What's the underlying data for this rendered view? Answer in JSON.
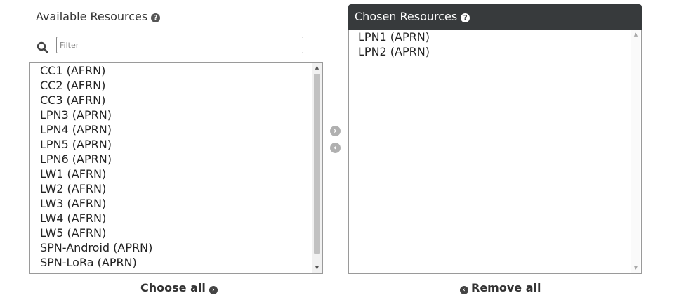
{
  "available": {
    "title": "Available Resources",
    "help_icon": "?",
    "filter_placeholder": "Filter",
    "items": [
      "CC1 (AFRN)",
      "CC2 (AFRN)",
      "CC3 (AFRN)",
      "LPN3 (APRN)",
      "LPN4 (APRN)",
      "LPN5 (APRN)",
      "LPN6 (APRN)",
      "LW1 (AFRN)",
      "LW2 (AFRN)",
      "LW3 (AFRN)",
      "LW4 (AFRN)",
      "LW5 (AFRN)",
      "SPN-Android (APRN)",
      "SPN-LoRa (APRN)",
      "SPN-Crystal (APRN)"
    ]
  },
  "chosen": {
    "title": "Chosen Resources",
    "help_icon": "?",
    "header_color": "#373a3c",
    "items": [
      "LPN1 (APRN)",
      "LPN2 (APRN)"
    ]
  },
  "controls": {
    "move_right_icon": "circle-arrow-right-icon",
    "move_left_icon": "circle-arrow-left-icon",
    "choose_all_label": "Choose all",
    "remove_all_label": "Remove all"
  }
}
